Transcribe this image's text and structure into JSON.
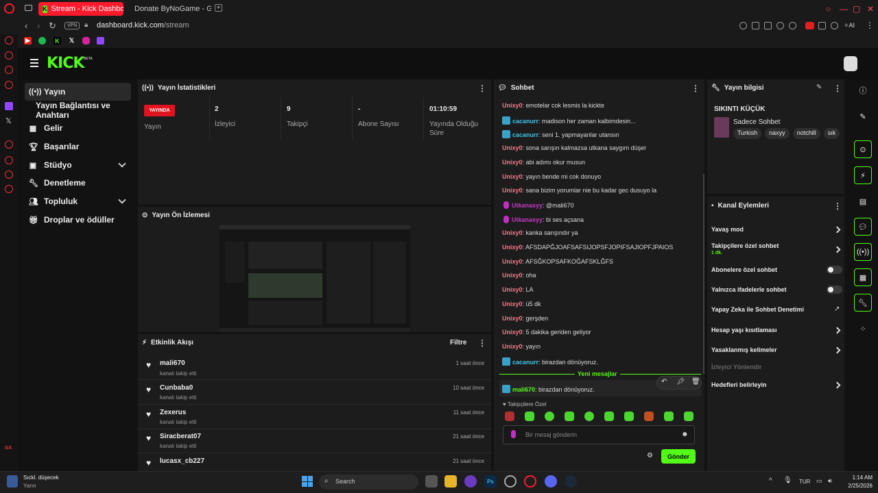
{
  "browser": {
    "tabs": [
      {
        "label": "Stream - Kick Dashboard",
        "active": true
      },
      {
        "label": "Donate ByNoGame - Gele",
        "active": false
      }
    ],
    "url_domain": "dashboard.kick.com",
    "url_path": "/stream",
    "vpn_label": "VPN",
    "ai_label": "AI",
    "bookmarks_icons": [
      "youtube-icon",
      "spotify-icon",
      "kick-icon",
      "x-icon",
      "instagram-icon",
      "twitch-icon"
    ]
  },
  "kick": {
    "logo": "KICK",
    "beta": "BETA",
    "nav": [
      {
        "label": "Yayın",
        "icon": "broadcast-icon"
      },
      {
        "label": "Yayın Bağlantısı ve Anahtarı"
      },
      {
        "label": "Gelir",
        "icon": "chart-icon"
      },
      {
        "label": "Başarılar",
        "icon": "trophy-icon"
      },
      {
        "label": "Stüdyo",
        "icon": "studio-icon"
      },
      {
        "label": "Denetleme",
        "icon": "wrench-icon"
      },
      {
        "label": "Topluluk",
        "icon": "people-icon"
      },
      {
        "label": "Droplar ve ödüller",
        "icon": "gift-icon"
      }
    ]
  },
  "stats": {
    "title": "Yayın İstatistikleri",
    "live_badge": "YAYINDA",
    "items": [
      {
        "value": "",
        "label": "Yayın"
      },
      {
        "value": "2",
        "label": "İzleyici"
      },
      {
        "value": "9",
        "label": "Takipçi"
      },
      {
        "value": "-",
        "label": "Abone Sayısı"
      },
      {
        "value": "01:10:59",
        "label": "Yayında Olduğu Süre"
      }
    ]
  },
  "preview": {
    "title": "Yayın Ön İzlemesi"
  },
  "events": {
    "title": "Etkinlik Akışı",
    "filter": "Filtre",
    "items": [
      {
        "name": "mali670",
        "action": "kanalı takip etti",
        "time": "1 saat önce"
      },
      {
        "name": "Cunbaba0",
        "action": "kanalı takip etti",
        "time": "10 saat önce"
      },
      {
        "name": "Zexerus",
        "action": "kanalı takip etti",
        "time": "11 saat önce"
      },
      {
        "name": "Siracberat07",
        "action": "kanalı takip etti",
        "time": "21 saat önce"
      },
      {
        "name": "lucasx_cb227",
        "action": "",
        "time": "21 saat önce"
      }
    ]
  },
  "chat": {
    "title": "Sohbet",
    "messages": [
      {
        "user": "Unixy0",
        "text": ": emotelar cok lesmis la kickte",
        "color": "#f7768e",
        "badge": ""
      },
      {
        "user": "cacanurr",
        "text": ": madison her zaman kalbimdesin...",
        "color": "#3fc4e8",
        "badge": "box"
      },
      {
        "user": "cacanurr",
        "text": ": seni 1. yapmayanlar utansın",
        "color": "#3fc4e8",
        "badge": "box"
      },
      {
        "user": "Unixy0",
        "text": ": sona sarışın kalmazsa utkana saygım düşer",
        "color": "#f7768e",
        "badge": ""
      },
      {
        "user": "Unixy0",
        "text": ": abi adımı okur musun",
        "color": "#f7768e",
        "badge": ""
      },
      {
        "user": "Unixy0",
        "text": ": yayın bende mi cok donuyo",
        "color": "#f7768e",
        "badge": ""
      },
      {
        "user": "Unixy0",
        "text": ": sana bizim yorumlar nie bu kadar gec dusuyo la",
        "color": "#f7768e",
        "badge": ""
      },
      {
        "user": "Utkanaxyy",
        "text": ": @mali670",
        "color": "#c03ac0",
        "badge": "mic"
      },
      {
        "user": "Utkanaxyy",
        "text": ": bi ses açsana",
        "color": "#c03ac0",
        "badge": "mic"
      },
      {
        "user": "Unixy0",
        "text": ": kanka sarışındır ya",
        "color": "#f7768e",
        "badge": ""
      },
      {
        "user": "Unixy0",
        "text": ": AFSDAPĞJOAFSAFSIJOPSFJOPIFSAJIOPFJPAIOS",
        "color": "#f7768e",
        "badge": ""
      },
      {
        "user": "Unixy0",
        "text": ": AFSĞKOPSAFKOĞAFSKLĞFS",
        "color": "#f7768e",
        "badge": ""
      },
      {
        "user": "Unixy0",
        "text": ": oha",
        "color": "#f7768e",
        "badge": ""
      },
      {
        "user": "Unixy0",
        "text": ": LA",
        "color": "#f7768e",
        "badge": ""
      },
      {
        "user": "Unixy0",
        "text": ": ü5 dk",
        "color": "#f7768e",
        "badge": ""
      },
      {
        "user": "Unixy0",
        "text": ": gerşden",
        "color": "#f7768e",
        "badge": ""
      },
      {
        "user": "Unixy0",
        "text": ": 5 dakika geriden geliyor",
        "color": "#f7768e",
        "badge": ""
      },
      {
        "user": "Unixy0",
        "text": ": yayın",
        "color": "#f7768e",
        "badge": ""
      },
      {
        "user": "cacanurr",
        "text": ": birazdan dönüyoruz.",
        "color": "#3fc4e8",
        "badge": "box"
      }
    ],
    "new_messages": "Yeni mesajlar",
    "highlight": {
      "user": "mali670",
      "text": ": birazdan dönüyoruz.",
      "color": "#53fc18"
    },
    "follower_only": "Takipçilere Özel",
    "input_placeholder": "Bir mesaj gönderin",
    "send": "Gönder"
  },
  "stream_info": {
    "title": "Yayın bilgisi",
    "stream_title": "SIKINTI KÜÇÜK",
    "category": "Sadece Sohbet",
    "tags": [
      "Turkish",
      "naxyy",
      "notchill",
      "sık"
    ]
  },
  "channel_actions": {
    "title": "Kanal Eylemleri",
    "items": [
      {
        "label": "Yavaş mod",
        "control": "chevron"
      },
      {
        "label": "Takipçilere özel sohbet",
        "sub": "1 dk.",
        "control": "chevron"
      },
      {
        "label": "Abonelere özel sohbet",
        "control": "toggle"
      },
      {
        "label": "Yalnızca ifadelerle sohbet",
        "control": "toggle"
      },
      {
        "label": "Yapay Zeka ile Sohbet Denetimi",
        "control": "external"
      },
      {
        "label": "Hesap yaşı kısıtlaması",
        "control": "chevron"
      },
      {
        "label": "Yasaklanmış kelimeler",
        "control": "chevron"
      },
      {
        "label": "İzleyici Yönlendir",
        "control": "none",
        "disabled": true
      },
      {
        "label": "Hedefleri belirleyin",
        "control": "chevron"
      }
    ]
  },
  "taskbar": {
    "weather_title": "Sıckl. düşecek",
    "weather_sub": "Yarın",
    "search": "Search",
    "lang": "TUR",
    "time": "1:14 AM",
    "date": "2/25/2026"
  }
}
